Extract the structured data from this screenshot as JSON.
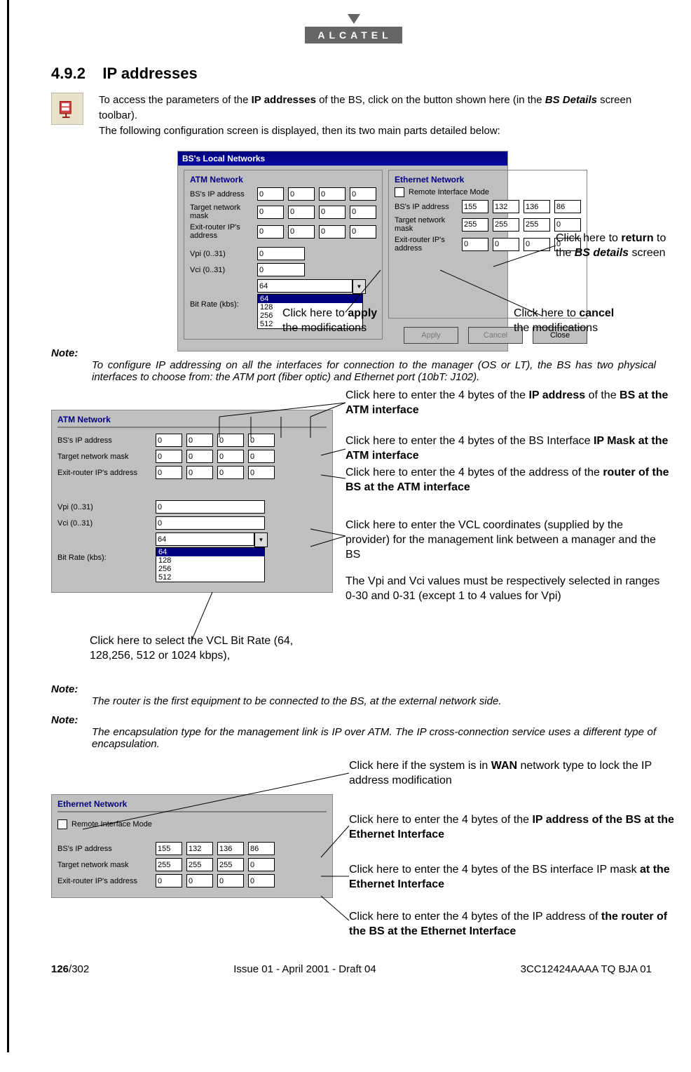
{
  "brand": "ALCATEL",
  "section_number": "4.9.2",
  "section_title": "IP addresses",
  "intro": {
    "part1": "To access the parameters of the ",
    "bold1": "IP addresses",
    "part2": " of the BS, click on the button shown here (in the ",
    "bold_italic": "BS Details",
    "part3": " screen toolbar).",
    "line2": "The following configuration screen is displayed, then its two main parts detailed below:"
  },
  "main_dialog": {
    "title": "BS's Local Networks",
    "atm_title": "ATM Network",
    "eth_title": "Ethernet Network",
    "lbl_bs_ip": "BS's IP address",
    "lbl_mask": "Target network mask",
    "lbl_router": "Exit-router IP's address",
    "lbl_vpi": "Vpi (0..31)",
    "lbl_vci": "Vci (0..31)",
    "lbl_bitrate": "Bit Rate (kbs):",
    "lbl_remote": "Remote Interface Mode",
    "atm_ip": [
      "0",
      "0",
      "0",
      "0"
    ],
    "atm_mask": [
      "0",
      "0",
      "0",
      "0"
    ],
    "atm_router": [
      "0",
      "0",
      "0",
      "0"
    ],
    "vpi": "0",
    "vci": "0",
    "bitrate_selected": "64",
    "bitrate_options": [
      "64",
      "128",
      "256",
      "512"
    ],
    "eth_ip": [
      "155",
      "132",
      "136",
      "86"
    ],
    "eth_mask": [
      "255",
      "255",
      "255",
      "0"
    ],
    "eth_router": [
      "0",
      "0",
      "0",
      "0"
    ],
    "btn_apply": "Apply",
    "btn_cancel": "Cancel",
    "btn_close": "Close"
  },
  "callouts_main": {
    "apply_pre": "Click here to  ",
    "apply_bold": "apply",
    "apply_post": " the modifications",
    "cancel_pre": "Click here to ",
    "cancel_bold": "cancel",
    "cancel_post": " the modifications",
    "close_pre": "Click here to ",
    "close_bold": "return",
    "close_post1": " to the ",
    "close_bi": "BS details",
    "close_post2": " screen"
  },
  "note1": "To configure IP addressing on all the interfaces for connection to the manager (OS or LT), the BS has two physical interfaces to choose from: the ATM port (fiber optic) and Ethernet port (10bT: J102).",
  "atm_detail": {
    "title": "ATM Network",
    "lbl_bs_ip": "BS's IP address",
    "lbl_mask": "Target network mask",
    "lbl_router": "Exit-router IP's address",
    "lbl_vpi": "Vpi (0..31)",
    "lbl_vci": "Vci (0..31)",
    "lbl_bitrate": "Bit Rate (kbs):",
    "ip": [
      "0",
      "0",
      "0",
      "0"
    ],
    "mask": [
      "0",
      "0",
      "0",
      "0"
    ],
    "router": [
      "0",
      "0",
      "0",
      "0"
    ],
    "vpi": "0",
    "vci": "0",
    "bitrate_selected": "64",
    "bitrate_options": [
      "64",
      "128",
      "256",
      "512"
    ]
  },
  "callouts_atm": {
    "c1_pre": "Click here to enter the 4 bytes of the ",
    "c1_bold": "IP address",
    "c1_post": " of the ",
    "c1_bold2": "BS at the ATM interface",
    "c2_pre": "Click here to enter the 4 bytes of the BS Interface ",
    "c2_bold": "IP Mask at the ATM interface",
    "c3_pre": "Click here to enter the 4 bytes of the address of the ",
    "c3_bold": "router of the BS at the ATM interface",
    "c4": "Click here to enter the VCL coordinates (supplied by the provider) for the management link between a manager and the BS",
    "c5": "The Vpi and Vci values must be respectively selected in ranges 0-30 and 0-31 (except 1 to 4 values for Vpi)",
    "c6": "Click here to select the VCL Bit Rate (64, 128,256, 512 or 1024 kbps),"
  },
  "note2": "The router is the first equipment to be connected to the BS, at the external network side.",
  "note3": "The encapsulation type for the management link is IP over ATM. The IP cross-connection service uses a different type of encapsulation.",
  "eth_detail": {
    "title": "Ethernet Network",
    "lbl_remote": "Remote Interface Mode",
    "lbl_bs_ip": "BS's IP address",
    "lbl_mask": "Target network mask",
    "lbl_router": "Exit-router IP's address",
    "ip": [
      "155",
      "132",
      "136",
      "86"
    ],
    "mask": [
      "255",
      "255",
      "255",
      "0"
    ],
    "router": [
      "0",
      "0",
      "0",
      "0"
    ]
  },
  "callouts_eth": {
    "c1_pre": "Click here if the system is in ",
    "c1_bold": "WAN",
    "c1_post": " network type to lock the IP address modification",
    "c2_pre": "Click here to enter the 4 bytes of the ",
    "c2_bold": "IP address of the BS at the Ethernet Interface",
    "c3_pre": "Click here to enter the 4 bytes of the BS interface IP mask ",
    "c3_bold": "at the Ethernet Interface",
    "c4_pre": "Click here to enter the 4 bytes of the IP address of ",
    "c4_bold": "the router of the BS at the Ethernet Interface"
  },
  "footer": {
    "page_current": "126",
    "page_total": "/302",
    "issue": "Issue 01 - April 2001 - Draft 04",
    "docref": "3CC12424AAAA TQ BJA 01"
  },
  "note_label": "Note:"
}
